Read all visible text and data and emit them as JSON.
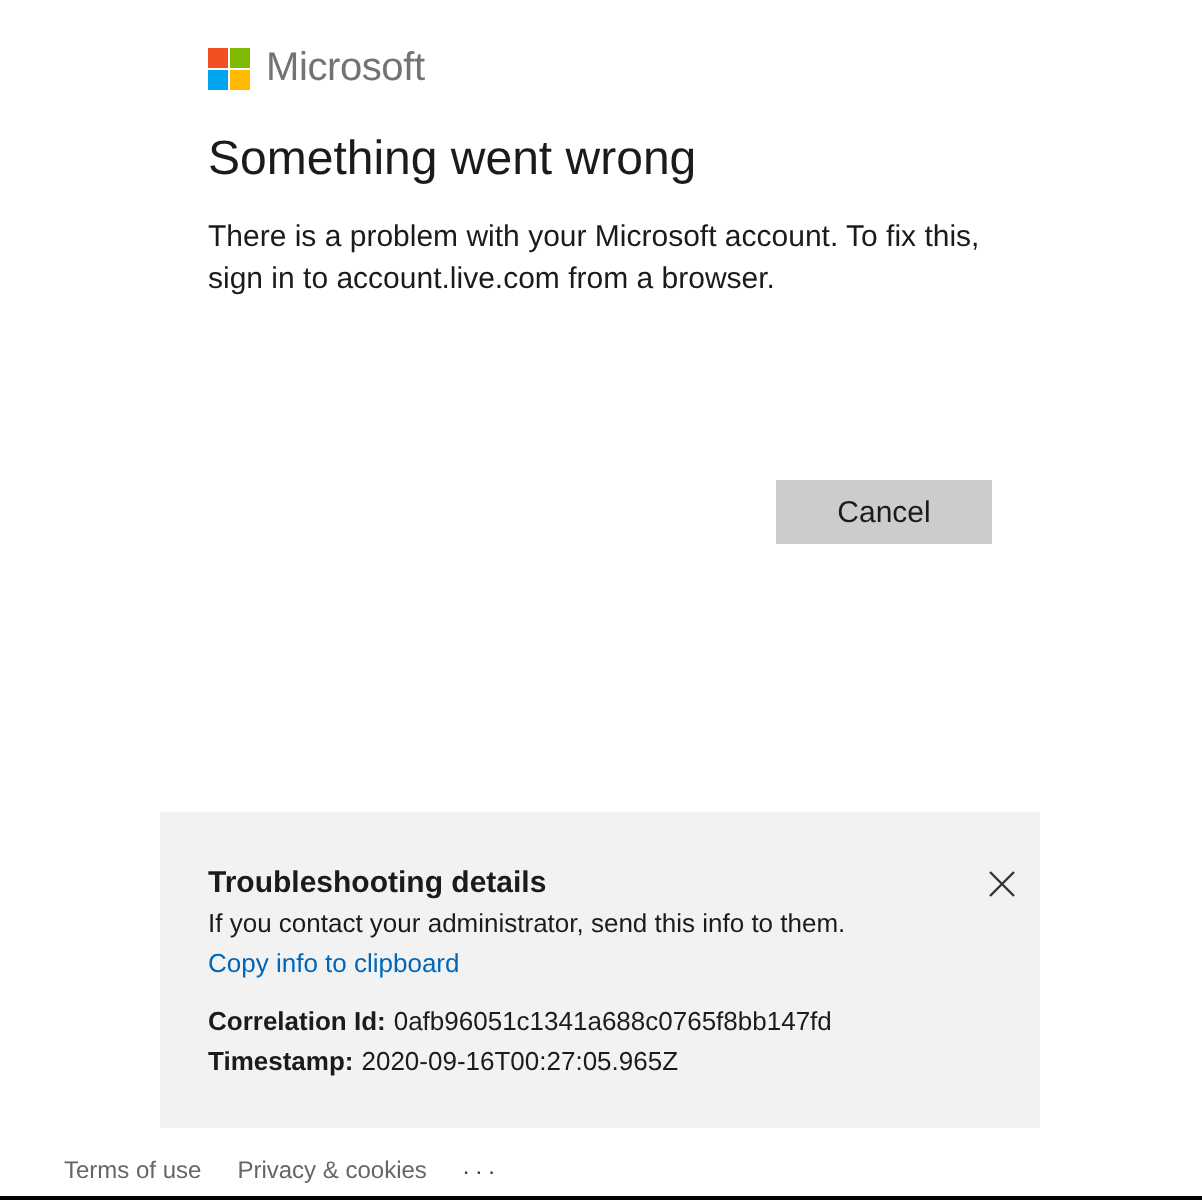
{
  "brand": {
    "name": "Microsoft"
  },
  "heading": "Something went wrong",
  "message": "There is a problem with your Microsoft account. To fix this, sign in to account.live.com from a browser.",
  "buttons": [
    {
      "label": "Cancel"
    }
  ],
  "troubleshooting": {
    "title": "Troubleshooting details",
    "description": "If you contact your administrator, send this info to them.",
    "copy_link": "Copy info to clipboard",
    "details": [
      {
        "label": "Correlation Id:",
        "value": "0afb96051c1341a688c0765f8bb147fd"
      },
      {
        "label": "Timestamp:",
        "value": "2020-09-16T00:27:05.965Z"
      }
    ]
  },
  "footer": {
    "links": [
      "Terms of use",
      "Privacy & cookies"
    ],
    "more": "..."
  }
}
